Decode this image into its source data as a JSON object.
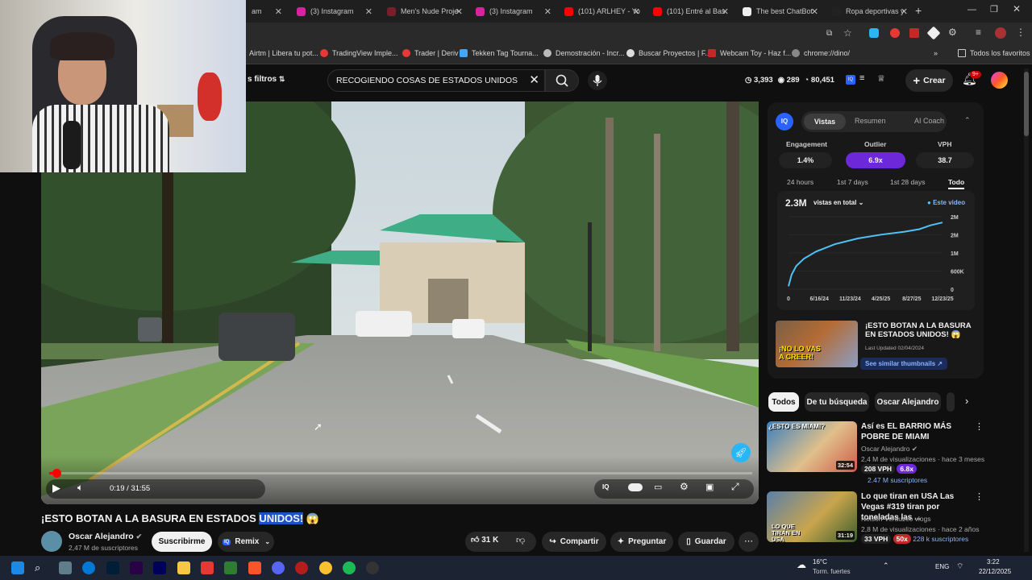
{
  "tabs": [
    {
      "label": "am",
      "color": "#444"
    },
    {
      "label": "(3) Instagram",
      "color": "#d6249f"
    },
    {
      "label": "Men's Nude Proje",
      "color": "#7b1d2b"
    },
    {
      "label": "(3) Instagram",
      "color": "#d6249f"
    },
    {
      "label": "(101) ARLHEY - Yo",
      "color": "#ff0000"
    },
    {
      "label": "(101) Entré al Bas",
      "color": "#ff0000"
    },
    {
      "label": "The best ChatBot",
      "color": "#eeeeee"
    },
    {
      "label": "Ropa deportivas y",
      "color": "#222"
    }
  ],
  "bookmarks": [
    "Airtm | Libera tu pot...",
    "TradingView Imple...",
    "Trader | Deriv",
    "Tekken Tag Tourna...",
    "Demostración - Incr...",
    "Buscar Proyectos | F...",
    "Webcam Toy - Haz f...",
    "chrome://dino/",
    "Todos los favoritos"
  ],
  "header": {
    "filters": "s filtros",
    "search_value": "RECOGIENDO COSAS DE ESTADOS UNIDOS",
    "stats": [
      "3,393",
      "289",
      "80,451"
    ],
    "create": "Crear",
    "notif_badge": "9+"
  },
  "player": {
    "time": "0:19 / 31:55",
    "progress": 0.0099
  },
  "video_info": {
    "title": "¡ESTO BOTAN A LA BASURA EN ESTADOS",
    "title_highlight": "UNIDOS!",
    "channel": "Oscar Alejandro",
    "subs": "2,47 M de suscriptores",
    "subscribe": "Suscribirme",
    "remix": "Remix",
    "likes": "31 K",
    "share": "Compartir",
    "ask": "Preguntar",
    "save": "Guardar"
  },
  "panel": {
    "logo": "IQ",
    "tabs": [
      "Vistas",
      "Resumen",
      "AI Coach"
    ],
    "metrics": [
      {
        "label": "Engagement",
        "value": "1.4%"
      },
      {
        "label": "Outlier",
        "value": "6.9x"
      },
      {
        "label": "VPH",
        "value": "38.7"
      }
    ],
    "ranges": [
      "24 hours",
      "1st 7 days",
      "1st 28 days",
      "Todo"
    ],
    "total": "2.3M",
    "total_label": "vistas en total",
    "legend": "Este video",
    "card_title": "¡ESTO BOTAN A LA BASURA EN ESTADOS UNIDOS! 😱",
    "card_updated": "Last Updated 02/04/2024",
    "card_btn": "See similar thumbnails ↗",
    "card_thumb_text": "¡NO LO VAS A CREER!"
  },
  "chart_data": {
    "type": "line",
    "x_ticks": [
      "0",
      "6/16/24",
      "11/23/24",
      "4/25/25",
      "8/27/25",
      "12/23/25"
    ],
    "y_ticks": [
      "2M",
      "2M",
      "1M",
      "600K",
      "0"
    ],
    "x": [
      0,
      0.02,
      0.05,
      0.1,
      0.18,
      0.3,
      0.45,
      0.6,
      0.75,
      0.85,
      0.92,
      1.0
    ],
    "values": [
      0.1,
      0.5,
      0.8,
      1.05,
      1.3,
      1.55,
      1.75,
      1.88,
      1.98,
      2.07,
      2.2,
      2.3
    ],
    "ylim": [
      0,
      2.5
    ]
  },
  "filter_chips": [
    "Todos",
    "De tu búsqueda",
    "Oscar Alejandro"
  ],
  "related": [
    {
      "title": "Así es EL BARRIO MÁS POBRE DE MIAMI",
      "channel": "Oscar Alejandro",
      "meta": "2,4 M de visualizaciones · hace 3 meses",
      "vph": "208 VPH",
      "outlier": "6.8x",
      "subs": "2.47 M suscriptores",
      "duration": "32:54",
      "thumb_text": "¿ESTO ES MIAMI?"
    },
    {
      "title": "Lo que tiran en USA Las Vegas #319 tiran por toneladas las ...",
      "channel": "Nelson Verduzco vlogs",
      "meta": "2,8 M de visualizaciones · hace 2 años",
      "vph": "33 VPH",
      "outlier": "50x",
      "subs": "228 k suscriptores",
      "duration": "31:19",
      "thumb_text": "LO QUE TIRAN EN USA"
    }
  ],
  "taskbar": {
    "weather": "16°C",
    "weather_desc": "Torm. fuertes",
    "lang": "ENG",
    "time": "3:22",
    "date": "22/12/2025"
  }
}
